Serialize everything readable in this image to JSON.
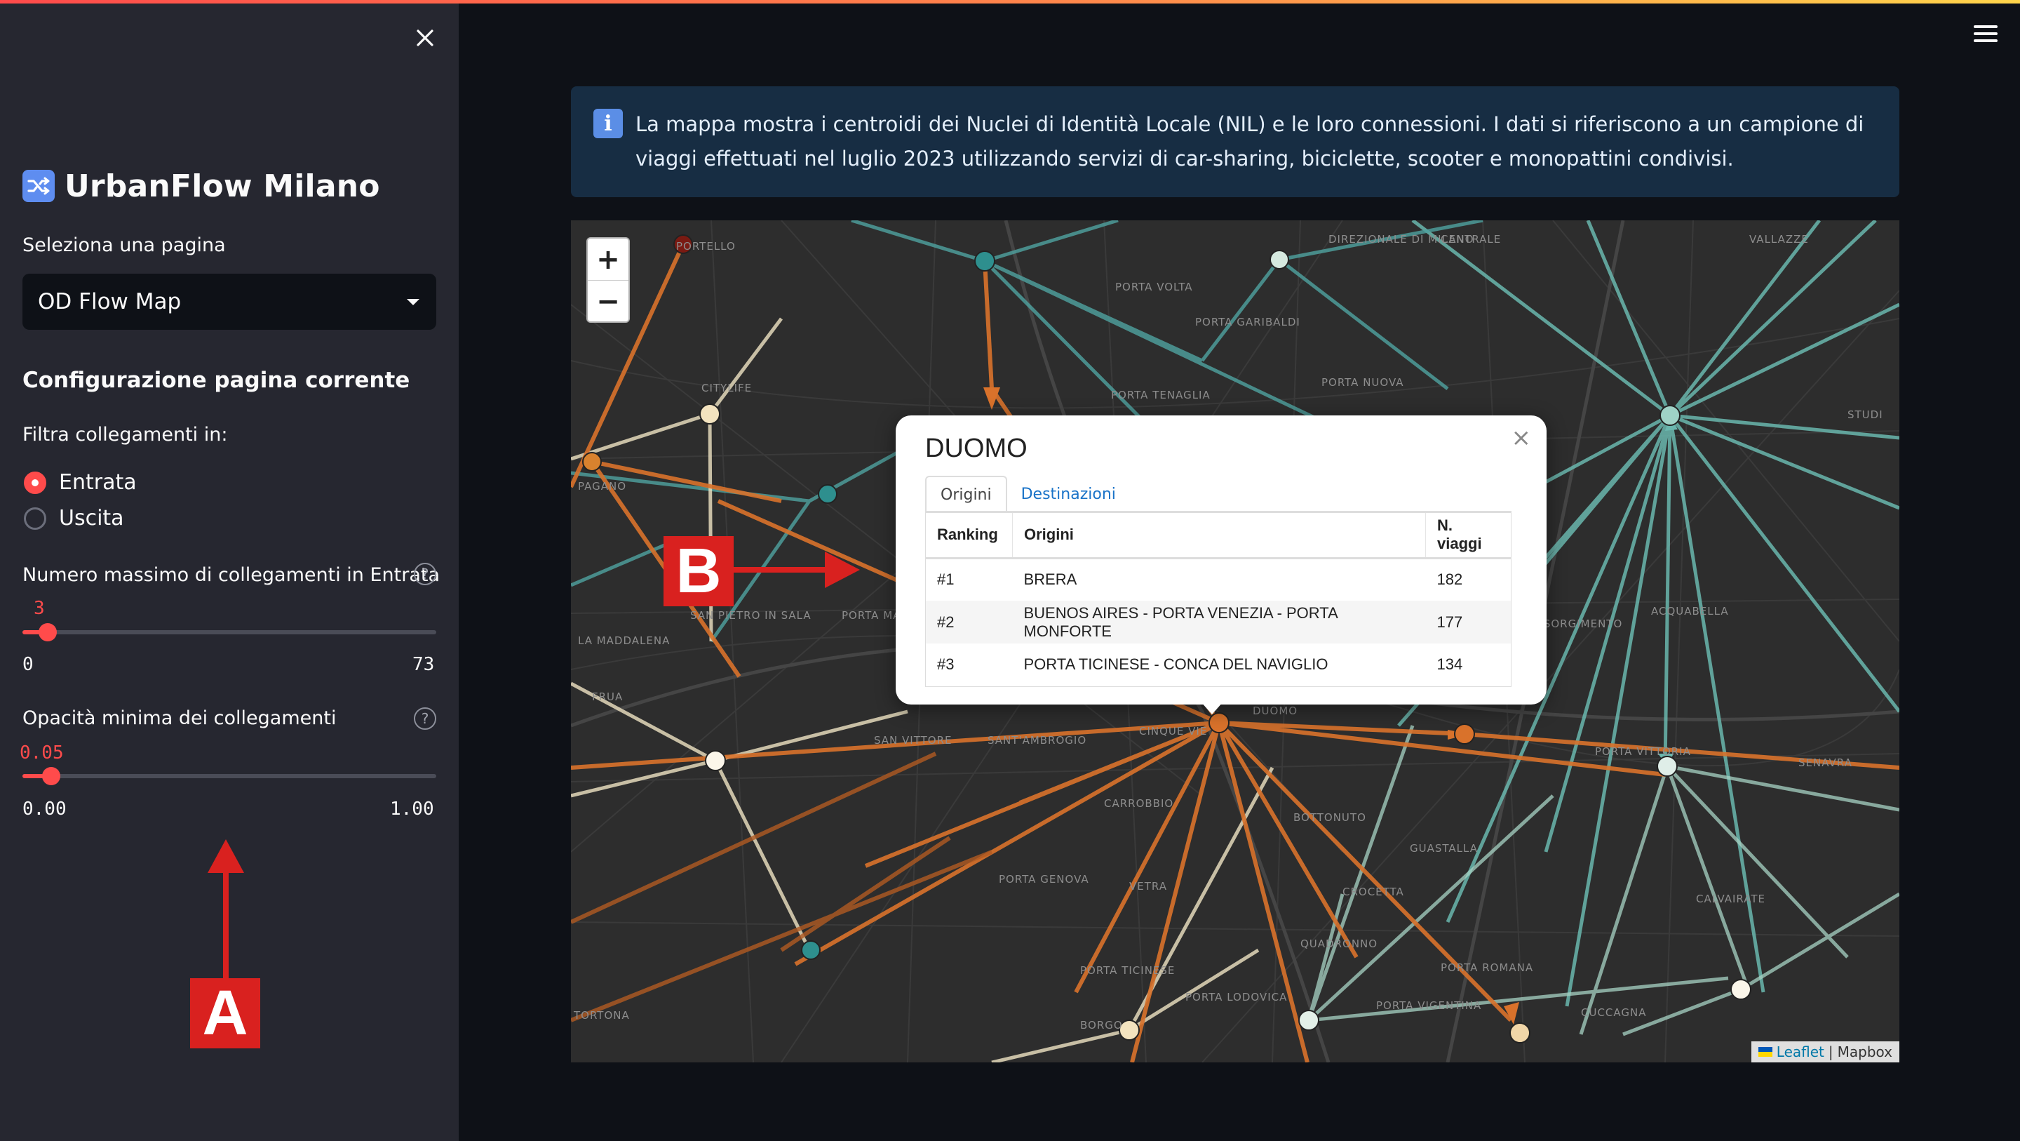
{
  "sidebar": {
    "app_title": "UrbanFlow Milano",
    "title_icon": "shuffle-icon",
    "page_select_label": "Seleziona una pagina",
    "page_select_value": "OD Flow Map",
    "config_heading": "Configurazione pagina corrente",
    "filter_label": "Filtra collegamenti in:",
    "radio_options": [
      "Entrata",
      "Uscita"
    ],
    "radio_selected": "Entrata",
    "max_links": {
      "label": "Numero massimo di collegamenti in Entrata",
      "value": "3",
      "min": "0",
      "max": "73",
      "fraction": 0.041
    },
    "min_opacity": {
      "label": "Opacità minima dei collegamenti",
      "value": "0.05",
      "min": "0.00",
      "max": "1.00",
      "fraction": 0.05
    }
  },
  "annotations": {
    "a": "A",
    "b": "B"
  },
  "info_box": {
    "icon": "info-icon",
    "text": "La mappa mostra i centroidi dei Nuclei di Identità Locale (NIL) e le loro connessioni. I dati si riferiscono a un campione di viaggi effettuati nel luglio 2023 utilizzando servizi di car-sharing, biciclette, scooter e monopattini condivisi."
  },
  "map": {
    "zoom_in": "+",
    "zoom_out": "−",
    "attribution_leaflet": "Leaflet",
    "attribution_sep": "|",
    "attribution_mapbox": "Mapbox",
    "place_labels": [
      "PORTELLO",
      "DIREZIONALE DI MILANO",
      "CENTRALE",
      "VALLAZZE",
      "PORTA VOLTA",
      "PORTA GARIBALDI",
      "PORTA NUOVA",
      "PORTA TENAGLIA",
      "CITYLIFE",
      "PAGANO",
      "LA MADDALENA",
      "SAN PIETRO IN SALA",
      "PORTA MAGENTA",
      "FRUA",
      "SAN VITTORE",
      "SANT'AMBROGIO",
      "CINQUE VIE",
      "DUOMO",
      "ACQUABELLA",
      "RISORGIMENTO",
      "PORTA VITTORIA",
      "SENAVRA",
      "CARROBBIO",
      "BOTTONUTO",
      "PORTA GENOVA",
      "VETRA",
      "CROCETTA",
      "GUASTALLA",
      "CALVAIRATE",
      "QUADRONNO",
      "PORTA TICINESE",
      "PORTA LODOVICA",
      "PORTA VIGENTINA",
      "PORTA ROMANA",
      "CUCCAGNA",
      "BORGO",
      "TORTONA",
      "STUDI"
    ],
    "colors": {
      "teal": "#6ab7ae",
      "orange": "#d9722b",
      "cream": "#f3e7c6",
      "dark_red": "#7a1a12"
    }
  },
  "popup": {
    "title": "DUOMO",
    "tabs": [
      "Origini",
      "Destinazioni"
    ],
    "active_tab": "Origini",
    "columns": [
      "Ranking",
      "Origini",
      "N. viaggi"
    ],
    "rows": [
      [
        "#1",
        "BRERA",
        "182"
      ],
      [
        "#2",
        "BUENOS AIRES - PORTA VENEZIA - PORTA MONFORTE",
        "177"
      ],
      [
        "#3",
        "PORTA TICINESE - CONCA DEL NAVIGLIO",
        "134"
      ]
    ]
  }
}
